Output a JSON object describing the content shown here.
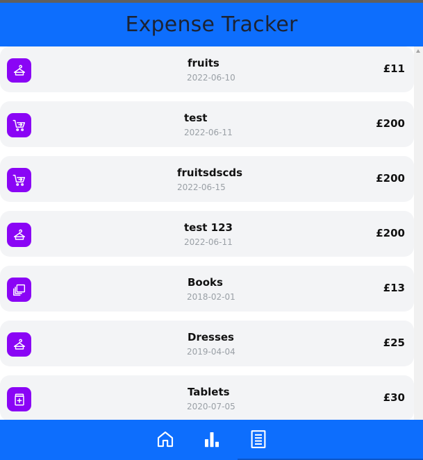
{
  "app": {
    "title": "Expense Tracker"
  },
  "expenses": [
    {
      "title": "fruits",
      "date": "2022-06-10",
      "amount": "£11",
      "icon": "hanger-icon"
    },
    {
      "title": "test",
      "date": "2022-06-11",
      "amount": "£200",
      "icon": "cart-icon"
    },
    {
      "title": "fruitsdscds",
      "date": "2022-06-15",
      "amount": "£200",
      "icon": "cart-icon"
    },
    {
      "title": "test 123",
      "date": "2022-06-11",
      "amount": "£200",
      "icon": "hanger-icon"
    },
    {
      "title": "Books",
      "date": "2018-02-01",
      "amount": "£13",
      "icon": "library-icon"
    },
    {
      "title": "Dresses",
      "date": "2019-04-04",
      "amount": "£25",
      "icon": "hanger-icon"
    },
    {
      "title": "Tablets",
      "date": "2020-07-05",
      "amount": "£30",
      "icon": "medicine-icon"
    }
  ],
  "nav": [
    {
      "icon": "home-icon"
    },
    {
      "icon": "bar-chart-icon"
    },
    {
      "icon": "receipt-icon"
    }
  ],
  "colors": {
    "header": "#0d6efd",
    "icon_bg": "#8a05f5",
    "card_bg": "#f3f4f6"
  }
}
